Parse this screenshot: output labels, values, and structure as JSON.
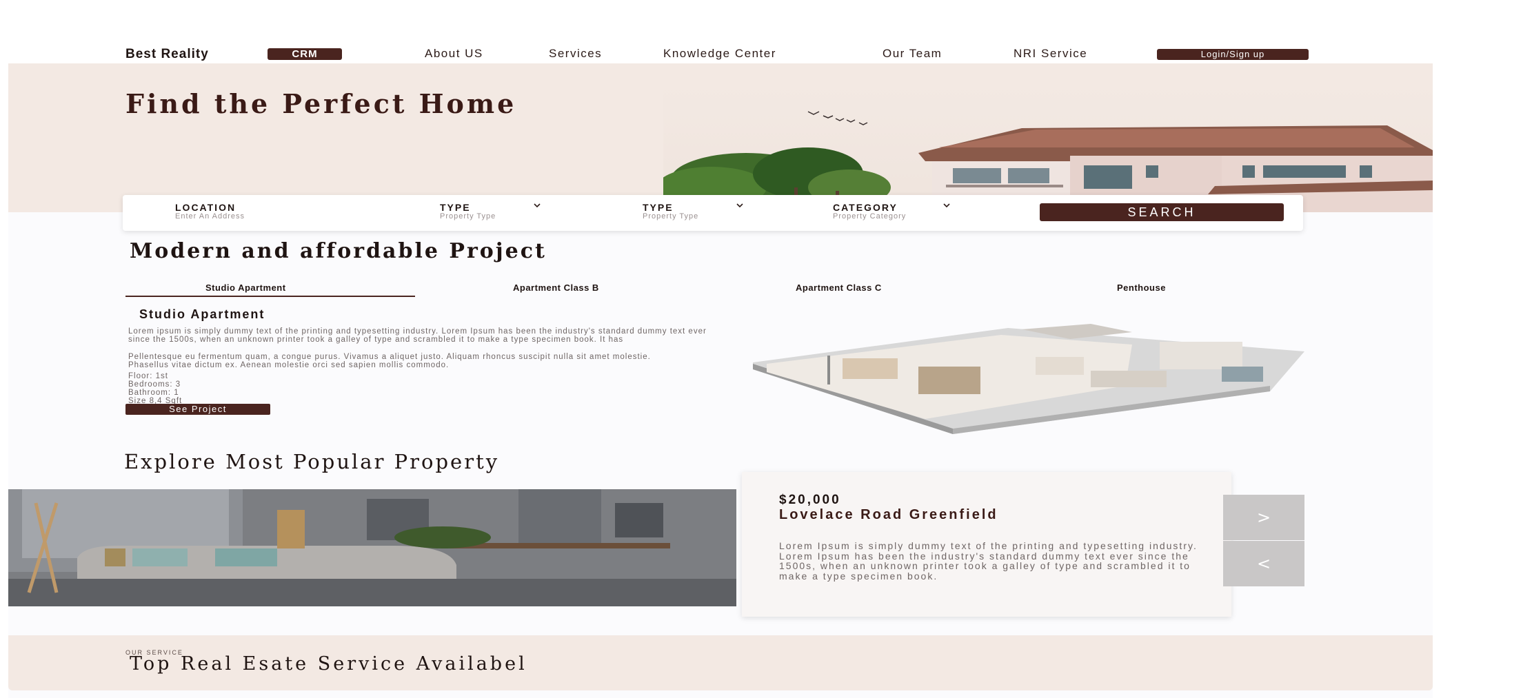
{
  "header": {
    "brand": "Best Reality",
    "badge": "CRM",
    "nav": [
      "About US",
      "Services",
      "Knowledge Center",
      "Our Team",
      "NRI Service"
    ],
    "login_label": "Login/Sign up"
  },
  "hero": {
    "title": "Find the Perfect Home"
  },
  "search": {
    "fields": [
      {
        "label": "LOCATION",
        "sub": "Enter An Address",
        "has_dropdown": false
      },
      {
        "label": "TYPE",
        "sub": "Property Type",
        "has_dropdown": true
      },
      {
        "label": "TYPE",
        "sub": "Property Type",
        "has_dropdown": true
      },
      {
        "label": "CATEGORY",
        "sub": "Property Category",
        "has_dropdown": true
      }
    ],
    "button_label": "SEARCH"
  },
  "projects": {
    "title": "Modern and affordable Project",
    "tabs": [
      "Studio Apartment",
      "Apartment Class B",
      "Apartment Class C",
      "Penthouse"
    ],
    "active_tab": 0,
    "detail": {
      "title": "Studio Apartment",
      "paragraph1": "Lorem ipsum is simply dummy text of the printing and typesetting industry. Lorem Ipsum has been the industry's standard dummy text ever since the 1500s, when an unknown printer took a galley of type and scrambled it to make a type specimen book. It has",
      "paragraph2": "Pellentesque eu fermentum quam, a congue purus. Vivamus a aliquet justo. Aliquam rhoncus suscipit nulla sit amet molestie. Phasellus vitae dictum ex. Aenean molestie orci sed sapien mollis commodo.",
      "floor": "Floor: 1st",
      "bedrooms": "Bedrooms: 3",
      "bathroom": "Bathroom: 1",
      "size": "Size 8,4 Sqft",
      "button_label": "See Project"
    }
  },
  "explore": {
    "title": "Explore Most Popular Property",
    "card": {
      "price": "$20,000",
      "title": "Lovelace Road Greenfield",
      "text": "Lorem Ipsum is simply dummy text of the printing  and typesetting industry. Lorem Ipsum has been  the industry's standard dummy text ever since the  1500s, when an unknown printer took a galley of  type and scrambled it to make a type specimen  book."
    },
    "next_label": ">",
    "prev_label": "<"
  },
  "service": {
    "eyebrow": "OUR SERVICE",
    "title": "Top Real Esate Service Availabel"
  },
  "colors": {
    "accent": "#4a241f",
    "hero_bg": "#f3e9e3",
    "page_bg": "#fbfbfd"
  }
}
